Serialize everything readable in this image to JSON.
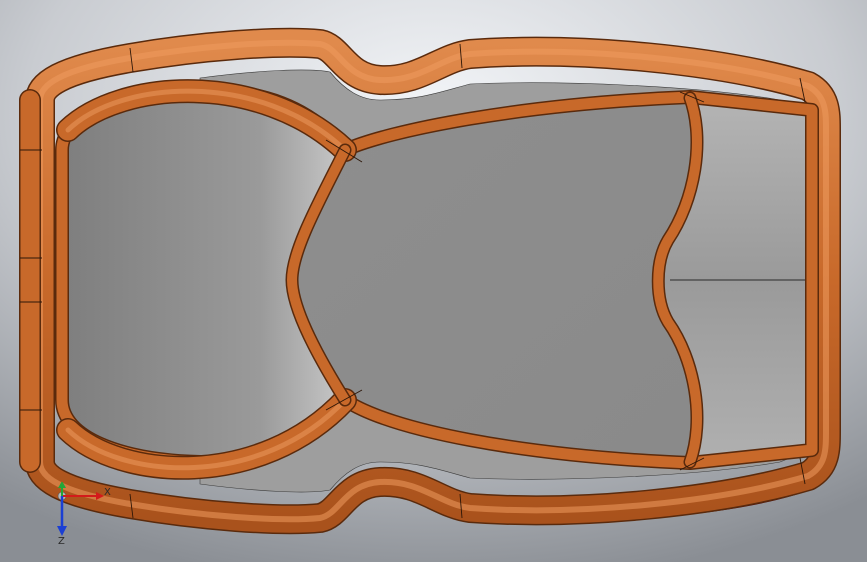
{
  "viewport": {
    "background_top": "#eef0f3",
    "background_bottom": "#8b8f95"
  },
  "model": {
    "frame_color": "#c8692a",
    "frame_dark": "#8c3f12",
    "frame_light": "#e8955a",
    "panel_color": "#8f8f8f",
    "panel_light": "#b9b9b9",
    "underside_color": "#9b1010",
    "edge_color": "#2c1608"
  },
  "triad": {
    "x_label": "X",
    "y_label": "Y",
    "z_label": "Z",
    "x_color": "#d31b1b",
    "y_color": "#22a638",
    "z_color": "#1b3fd3"
  }
}
